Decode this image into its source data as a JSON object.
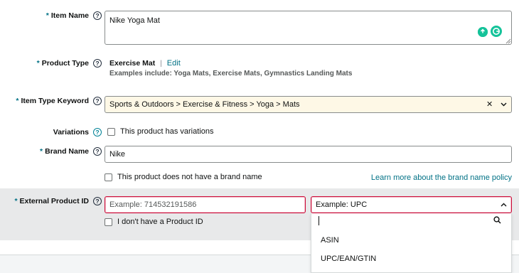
{
  "item_name": {
    "label": "Item Name",
    "required_mark": "*",
    "value": "Nike Yoga Mat"
  },
  "product_type": {
    "label": "Product Type",
    "required_mark": "*",
    "value": "Exercise Mat",
    "separator": "|",
    "edit_label": "Edit",
    "examples": "Examples include: Yoga Mats, Exercise Mats, Gymnastics Landing Mats"
  },
  "item_type_keyword": {
    "label": "Item Type Keyword",
    "required_mark": "*",
    "value": "Sports & Outdoors > Exercise & Fitness > Yoga > Mats",
    "clear_glyph": "✕",
    "chevron_glyph": "⌄",
    "highlight_color": "#fef8e6"
  },
  "variations": {
    "label": "Variations",
    "checkbox_label": "This product has variations"
  },
  "brand_name": {
    "label": "Brand Name",
    "required_mark": "*",
    "value": "Nike",
    "no_brand_label": "This product does not have a brand name",
    "learn_more_link": "Learn more about the brand name policy"
  },
  "external_product_id": {
    "label": "External Product ID",
    "required_mark": "*",
    "id_placeholder": "Example: 714532191586",
    "type_placeholder": "Example: UPC",
    "no_id_label": "I don't have a Product ID",
    "options": [
      "ASIN",
      "UPC/EAN/GTIN"
    ],
    "error_color": "#cc0c39"
  },
  "icons": {
    "help": "?",
    "search": "search-icon"
  },
  "colors": {
    "teal_link": "#007185",
    "band_gray": "#e8e9ea"
  }
}
